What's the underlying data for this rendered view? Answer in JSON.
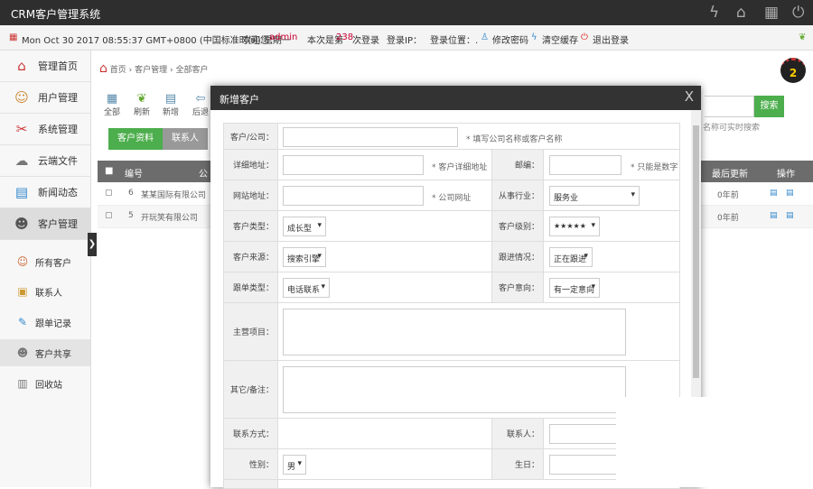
{
  "app": {
    "title": "CRM客户管理系统"
  },
  "info": {
    "datetime": "Mon Oct 30 2017 08:55:37 GMT+0800 (中国标准时间) 星期一",
    "welcome_label": "欢迎您：",
    "user": "admin",
    "login_prefix": "本次是第",
    "login_count": "238",
    "login_suffix": "次登录",
    "ip_label": "登录IP：",
    "location_label": "登录位置：.",
    "change_pwd": "修改密码",
    "clear_cache": "清空缓存",
    "logout": "退出登录"
  },
  "sidebar": {
    "items": [
      {
        "label": "管理首页"
      },
      {
        "label": "用户管理"
      },
      {
        "label": "系统管理"
      },
      {
        "label": "云端文件"
      },
      {
        "label": "新闻动态"
      },
      {
        "label": "客户管理"
      }
    ],
    "sub": [
      {
        "label": "所有客户"
      },
      {
        "label": "联系人"
      },
      {
        "label": "跟单记录"
      },
      {
        "label": "客户共享"
      },
      {
        "label": "回收站"
      }
    ]
  },
  "breadcrumb": [
    "首页",
    "客户管理",
    "全部客户"
  ],
  "notification_count": "2",
  "toolbar": [
    {
      "label": "全部"
    },
    {
      "label": "刷新"
    },
    {
      "label": "新增"
    },
    {
      "label": "后退"
    }
  ],
  "tabs": [
    {
      "label": "客户资料"
    },
    {
      "label": "联系人"
    }
  ],
  "search": {
    "button": "搜索",
    "hint": "名称可实时搜索"
  },
  "table": {
    "headers": [
      "编号",
      "公",
      "最后更新",
      "操作"
    ],
    "rows": [
      {
        "id": "6",
        "name": "某某国际有限公司",
        "updated": "0年前"
      },
      {
        "id": "5",
        "name": "开玩笑有限公司",
        "updated": "0年前"
      }
    ]
  },
  "modal": {
    "title": "新增客户",
    "close": "X",
    "fields": {
      "company": {
        "label": "客户/公司：",
        "hint": "* 填写公司名称或客户名称"
      },
      "address": {
        "label": "详细地址：",
        "hint": "* 客户详细地址"
      },
      "zip": {
        "label": "邮编：",
        "hint": "* 只能是数字"
      },
      "website": {
        "label": "网站地址：",
        "hint": "* 公司网址"
      },
      "industry": {
        "label": "从事行业：",
        "value": "服务业"
      },
      "ctype": {
        "label": "客户类型：",
        "value": "成长型"
      },
      "level": {
        "label": "客户级别：",
        "value": "★★★★★"
      },
      "source": {
        "label": "客户来源：",
        "value": "搜索引擎"
      },
      "progress": {
        "label": "跟进情况：",
        "value": "正在跟进"
      },
      "ftype": {
        "label": "跟单类型：",
        "value": "电话联系"
      },
      "intent": {
        "label": "客户意向：",
        "value": "有一定意向"
      },
      "business": {
        "label": "主营项目："
      },
      "remark": {
        "label": "其它/备注："
      },
      "contact_method": {
        "label": "联系方式："
      },
      "contact": {
        "label": "联系人："
      },
      "gender": {
        "label": "性别：",
        "value": "男"
      },
      "birthday": {
        "label": "生日："
      }
    }
  }
}
